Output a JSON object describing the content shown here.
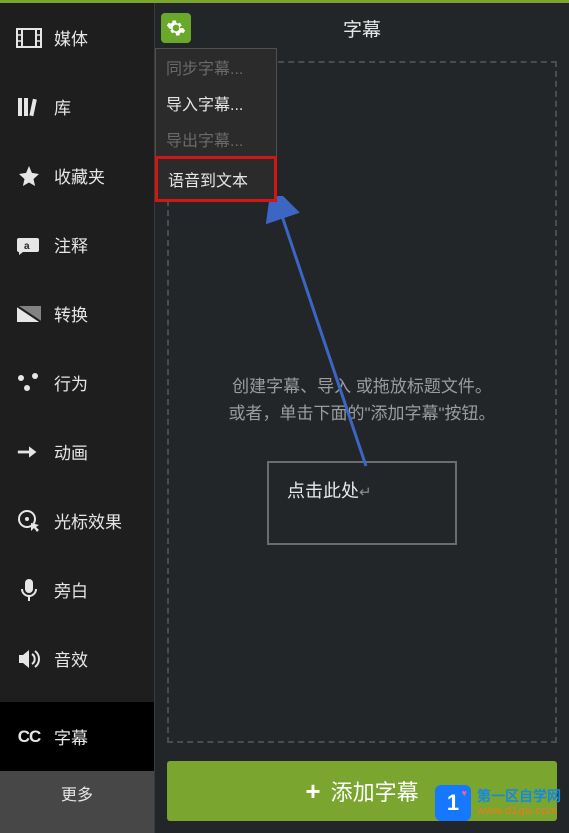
{
  "header": {
    "title": "字幕"
  },
  "sidebar": {
    "items": [
      {
        "label": "媒体"
      },
      {
        "label": "库"
      },
      {
        "label": "收藏夹"
      },
      {
        "label": "注释"
      },
      {
        "label": "转换"
      },
      {
        "label": "行为"
      },
      {
        "label": "动画"
      },
      {
        "label": "光标效果"
      },
      {
        "label": "旁白"
      },
      {
        "label": "音效"
      },
      {
        "label": "字幕"
      }
    ],
    "more": "更多"
  },
  "dropdown": {
    "items": [
      {
        "label": "同步字幕...",
        "disabled": true
      },
      {
        "label": "导入字幕...",
        "disabled": false
      },
      {
        "label": "导出字幕...",
        "disabled": true
      },
      {
        "label": "语音到文本",
        "highlight": true
      }
    ]
  },
  "dropzone": {
    "text_line1": "创建字幕、导入 或拖放标题文件。",
    "text_line2": "或者，单击下面的\"添加字幕\"按钮。",
    "click_text": "点击此处"
  },
  "add_button": {
    "label": "添加字幕"
  },
  "watermark": {
    "cn": "第一区自学网",
    "en": "www.d1qu.com",
    "badge": "1"
  }
}
